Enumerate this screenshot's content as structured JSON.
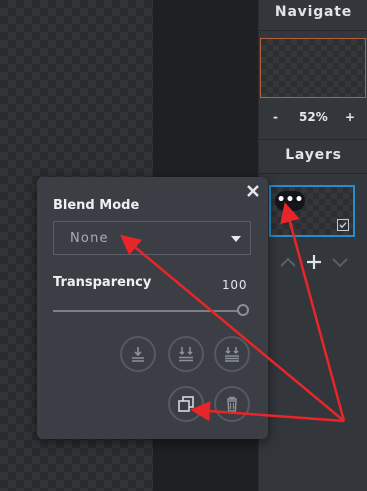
{
  "navigate": {
    "title": "Navigate",
    "zoom_out_label": "-",
    "zoom_value": "52%",
    "zoom_in_label": "+"
  },
  "layers": {
    "title": "Layers",
    "more_label": "•••"
  },
  "blend_popup": {
    "blend_mode_label": "Blend Mode",
    "blend_mode_value": "None",
    "transparency_label": "Transparency",
    "transparency_value": "100",
    "close_label": "×"
  },
  "colors": {
    "accent": "#1f8fd0",
    "arrow": "#e8262a",
    "nav_border": "#b3623e"
  }
}
